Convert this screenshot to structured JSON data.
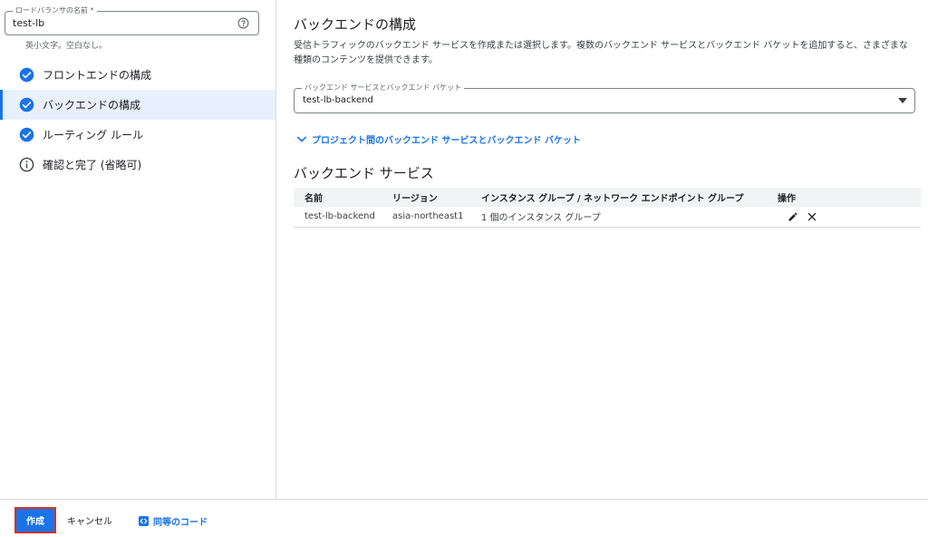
{
  "left_panel": {
    "lb_name": {
      "label": "ロードバランサの名前 *",
      "value": "test-lb",
      "hint": "英小文字。空白なし。",
      "help_icon": "help-circle-icon"
    },
    "steps": [
      {
        "label": "フロントエンドの構成",
        "icon": "check-circle-icon",
        "active": false
      },
      {
        "label": "バックエンドの構成",
        "icon": "check-circle-icon",
        "active": true
      },
      {
        "label": "ルーティング ルール",
        "icon": "check-circle-icon",
        "active": false
      },
      {
        "label": "確認と完了 (省略可)",
        "icon": "info-icon",
        "active": false
      }
    ]
  },
  "main": {
    "title": "バックエンドの構成",
    "description": "受信トラフィックのバックエンド サービスを作成または選択します。複数のバックエンド サービスとバックエンド バケットを追加すると、さまざまな種類のコンテンツを提供できます。",
    "backend_select": {
      "label": "バックエンド サービスとバックエンド バケット",
      "value": "test-lb-backend"
    },
    "cross_project_link": "プロジェクト間のバックエンド サービスとバックエンド バケット",
    "backend_services": {
      "title": "バックエンド サービス",
      "columns": [
        "名前",
        "リージョン",
        "インスタンス グループ / ネットワーク エンドポイント グループ",
        "操作"
      ],
      "rows": [
        {
          "name": "test-lb-backend",
          "region": "asia-northeast1",
          "group": "1 個のインスタンス グループ"
        }
      ]
    }
  },
  "footer": {
    "create_label": "作成",
    "cancel_label": "キャンセル",
    "equivalent_code_label": "同等のコード"
  },
  "colors": {
    "accent": "#1a73e8",
    "active_step_bg": "#e8f0fe",
    "highlight_border": "#d93025"
  }
}
